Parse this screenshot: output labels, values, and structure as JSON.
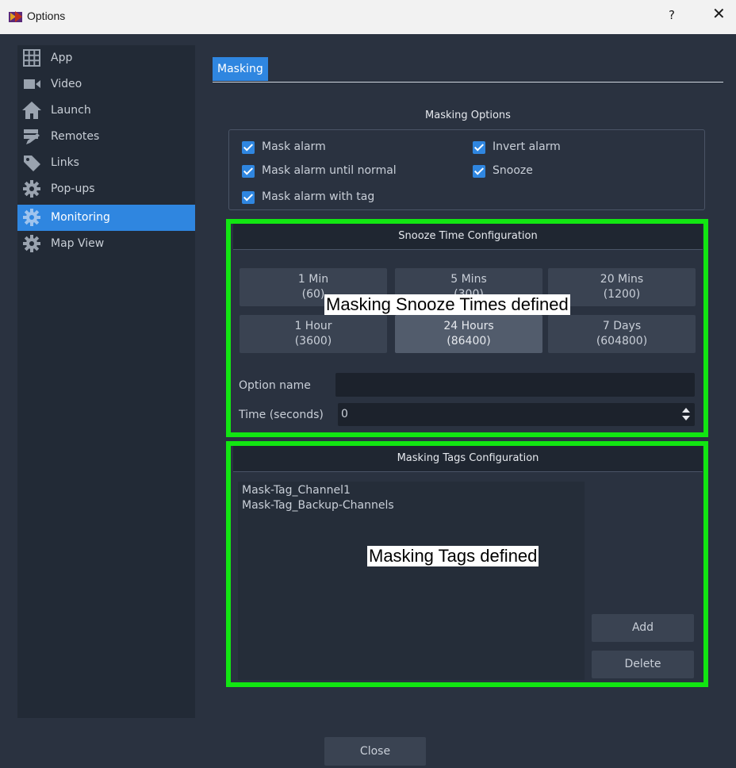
{
  "window": {
    "title": "Options",
    "help_label": "?",
    "close_label": "✕"
  },
  "sidebar": {
    "items": [
      {
        "label": "App",
        "icon": "grid-icon"
      },
      {
        "label": "Video",
        "icon": "video-camera-icon"
      },
      {
        "label": "Launch",
        "icon": "home-icon"
      },
      {
        "label": "Remotes",
        "icon": "remote-edit-icon"
      },
      {
        "label": "Links",
        "icon": "tag-icon"
      },
      {
        "label": "Pop-ups",
        "icon": "gear-icon"
      },
      {
        "label": "Monitoring",
        "icon": "gear-icon",
        "active": true
      },
      {
        "label": "Map View",
        "icon": "gear-icon"
      }
    ]
  },
  "tabs": [
    {
      "label": "Masking",
      "active": true
    }
  ],
  "masking_options": {
    "title": "Masking Options",
    "checkboxes": [
      {
        "label": "Mask alarm",
        "checked": true
      },
      {
        "label": "Mask alarm until normal",
        "checked": true
      },
      {
        "label": "Mask alarm with tag",
        "checked": true
      },
      {
        "label": "Invert alarm",
        "checked": true
      },
      {
        "label": "Snooze",
        "checked": true
      }
    ]
  },
  "snooze": {
    "title": "Snooze Time Configuration",
    "buttons": [
      {
        "line1": "1 Min",
        "line2": "(60)"
      },
      {
        "line1": "5 Mins",
        "line2": "(300)"
      },
      {
        "line1": "20 Mins",
        "line2": "(1200)"
      },
      {
        "line1": "1 Hour",
        "line2": "(3600)"
      },
      {
        "line1": "24 Hours",
        "line2": "(86400)",
        "selected": true
      },
      {
        "line1": "7 Days",
        "line2": "(604800)"
      }
    ],
    "option_name_label": "Option name",
    "option_name_value": "",
    "time_label": "Time (seconds)",
    "time_value": "0",
    "callout": "Masking Snooze Times defined"
  },
  "tags": {
    "title": "Masking Tags Configuration",
    "items": [
      "Mask-Tag_Channel1",
      "Mask-Tag_Backup-Channels"
    ],
    "add_label": "Add",
    "delete_label": "Delete",
    "callout": "Masking Tags defined"
  },
  "footer": {
    "close_label": "Close"
  },
  "colors": {
    "accent": "#2f86e0",
    "highlight": "#12e612",
    "background": "#2a3240"
  }
}
